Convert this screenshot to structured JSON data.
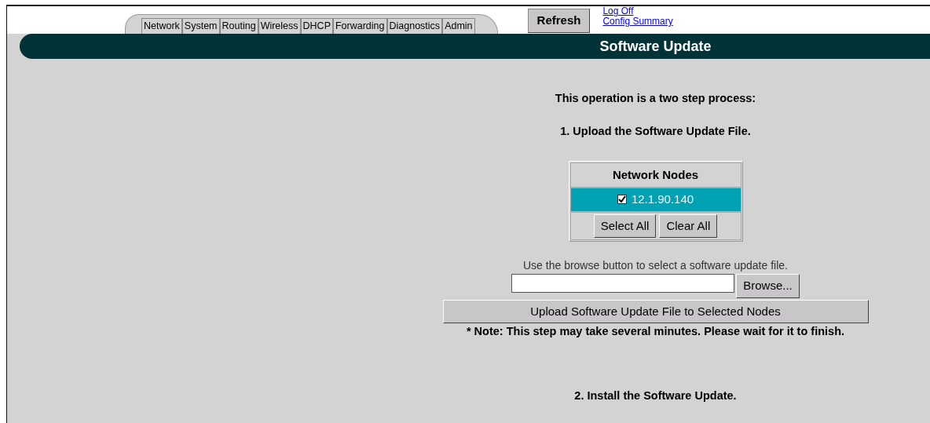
{
  "tabs": [
    {
      "label": "Network",
      "selected": false
    },
    {
      "label": "System",
      "selected": false
    },
    {
      "label": "Routing",
      "selected": false
    },
    {
      "label": "Wireless",
      "selected": false
    },
    {
      "label": "DHCP",
      "selected": false
    },
    {
      "label": "Forwarding",
      "selected": false
    },
    {
      "label": "Diagnostics",
      "selected": false
    },
    {
      "label": "Admin",
      "selected": false
    }
  ],
  "refresh_button": "Refresh",
  "links": [
    "Log Off",
    "Config Summary"
  ],
  "page_title": "Software Update",
  "intro": "This operation is a two step process:",
  "step_1": "1. Upload the Software Update File.",
  "nodes_table": {
    "heading": "Network Nodes",
    "nodes": [
      {
        "address": "12.1.90.140",
        "checked": true
      }
    ],
    "buttons": [
      "Select All",
      "Clear All"
    ]
  },
  "browse_hint": "Use the browse button to select a software update file.",
  "browse_button": "Browse...",
  "upload_button": "Upload Software Update File to Selected Nodes",
  "note": "* Note: This step may take several minutes. Please wait for it to finish.",
  "step_2": "2. Install the Software Update."
}
